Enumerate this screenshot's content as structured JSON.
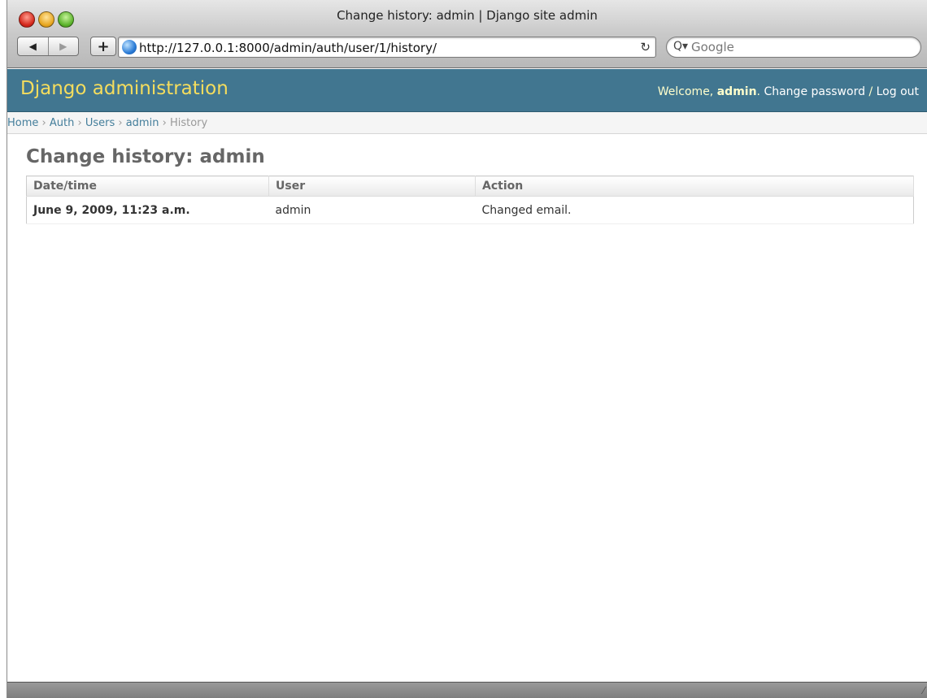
{
  "window": {
    "title": "Change history: admin | Django site admin"
  },
  "toolbar": {
    "back_icon": "◀",
    "forward_icon": "▶",
    "add_icon": "+",
    "url": "http://127.0.0.1:8000/admin/auth/user/1/history/",
    "reload_icon": "↻",
    "search_placeholder": "Google",
    "search_icon": "Q▾"
  },
  "header": {
    "branding": "Django administration",
    "welcome": "Welcome,",
    "username": "admin",
    "period": ".",
    "change_password": "Change password",
    "separator": "/",
    "logout": "Log out"
  },
  "breadcrumbs": {
    "items": [
      {
        "label": "Home",
        "link": true
      },
      {
        "label": "Auth",
        "link": true
      },
      {
        "label": "Users",
        "link": true
      },
      {
        "label": "admin",
        "link": true
      },
      {
        "label": "History",
        "link": false
      }
    ],
    "separator": "›"
  },
  "main": {
    "title": "Change history: admin",
    "table": {
      "columns": [
        "Date/time",
        "User",
        "Action"
      ],
      "rows": [
        {
          "datetime": "June 9, 2009, 11:23 a.m.",
          "user": "admin",
          "action": "Changed email."
        }
      ]
    }
  },
  "colors": {
    "header_bg": "#417690",
    "branding": "#f5dd5d",
    "link": "#447e9b"
  }
}
